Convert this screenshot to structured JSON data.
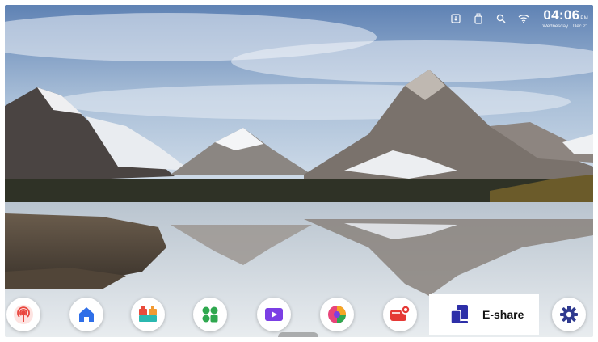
{
  "status_bar": {
    "icons": [
      "input-source-icon",
      "usb-icon",
      "search-icon",
      "wifi-icon"
    ],
    "time": "04:06",
    "ampm": "PM",
    "weekday": "Wednesday",
    "date": "Dec 21"
  },
  "dock": {
    "apps": [
      {
        "name": "broadcast-app",
        "color": "#e9473f"
      },
      {
        "name": "home-app",
        "color": "#2f6fe8"
      },
      {
        "name": "blocks-app",
        "color": "#e94b3c"
      },
      {
        "name": "apps-grid-app",
        "color": "#2fa84f"
      },
      {
        "name": "video-call-app",
        "color": "#7b3fe4"
      },
      {
        "name": "palette-app",
        "color": "#e8447a"
      },
      {
        "name": "recorder-app",
        "color": "#e53935"
      }
    ],
    "eshare": {
      "label": "E-share",
      "color": "#2d2fa8"
    },
    "settings": {
      "color": "#2f3a8f"
    }
  }
}
